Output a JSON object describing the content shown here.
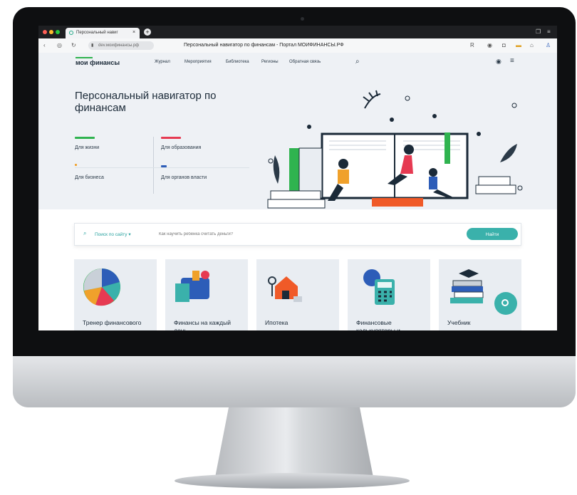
{
  "browser": {
    "tab_title": "Персональный навиг",
    "tab_close": "×",
    "new_tab": "+",
    "url": "dev.моифинансы.рф",
    "page_title": "Персональный навигатор по финансам - Портал МОИФИНАНСЫ.РФ"
  },
  "nav": {
    "logo": "мои финансы",
    "links": [
      "Журнал",
      "Мероприятия",
      "Библиотека",
      "Регионы",
      "Обратная связь"
    ]
  },
  "hero": {
    "title": "Персональный навигатор по финансам",
    "categories": [
      {
        "label": "Для жизни",
        "color": "#2fb34f"
      },
      {
        "label": "Для образования",
        "color": "#e63a52"
      },
      {
        "label": "Для бизнеса",
        "color": "#f0a12b"
      },
      {
        "label": "Для органов власти",
        "color": "#2d5db8"
      }
    ]
  },
  "search": {
    "scope": "Поиск по сайту",
    "placeholder": "Как научить ребенка считать деньги?",
    "button": "Найти"
  },
  "cards": [
    {
      "label": "Тренер финансового"
    },
    {
      "label": "Финансы на каждый день"
    },
    {
      "label": "Ипотека"
    },
    {
      "label": "Финансовые калькуляторы и"
    },
    {
      "label": "Учебник"
    }
  ],
  "colors": {
    "accent": "#3ab1ab",
    "text_dark": "#1b2a38",
    "hero_bg": "#eef1f5"
  }
}
